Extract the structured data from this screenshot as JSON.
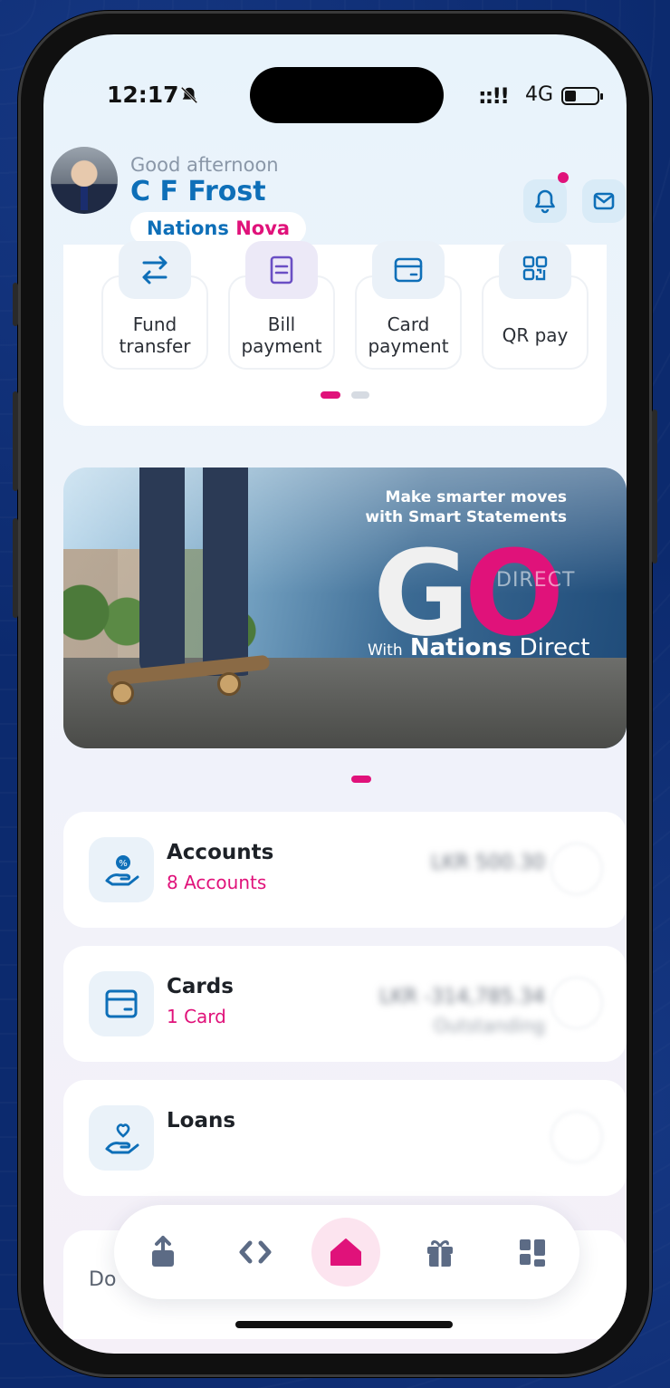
{
  "status_bar": {
    "time": "12:17",
    "network": "4G"
  },
  "header": {
    "greeting": "Good afternoon",
    "user_name": "C F Frost",
    "brand_primary": "Nations",
    "brand_secondary": "Nova"
  },
  "quick_actions": [
    {
      "label_line1": "Fund",
      "label_line2": "transfer",
      "icon": "swap-arrows-icon"
    },
    {
      "label_line1": "Bill",
      "label_line2": "payment",
      "icon": "bill-icon"
    },
    {
      "label_line1": "Card",
      "label_line2": "payment",
      "icon": "card-icon"
    },
    {
      "label_line1": "QR pay",
      "label_line2": "",
      "icon": "qr-code-icon"
    }
  ],
  "banner": {
    "tagline_line1": "Make smarter moves",
    "tagline_line2": "with Smart Statements",
    "go_g": "G",
    "go_o": "O",
    "direct_small": "DIRECT",
    "with": "With",
    "brand_bold": "Nations",
    "brand_rest": " Direct"
  },
  "products": [
    {
      "title": "Accounts",
      "subtitle": "8 Accounts",
      "amount": "LKR 500.30",
      "amount_sub": "",
      "icon": "money-hand-icon"
    },
    {
      "title": "Cards",
      "subtitle": "1 Card",
      "amount": "LKR -314,785.34",
      "amount_sub": "Outstanding",
      "icon": "card-icon"
    },
    {
      "title": "Loans",
      "subtitle": "",
      "amount": "",
      "amount_sub": "",
      "icon": "heart-hand-icon"
    }
  ],
  "partial_section": {
    "text": "Do"
  },
  "bottom_nav": [
    {
      "name": "share",
      "icon": "share-upload-icon"
    },
    {
      "name": "transfer",
      "icon": "code-arrows-icon"
    },
    {
      "name": "home",
      "icon": "home-icon",
      "active": true
    },
    {
      "name": "rewards",
      "icon": "gift-icon"
    },
    {
      "name": "more",
      "icon": "grid-icon"
    }
  ],
  "colors": {
    "primary": "#0e6fb8",
    "accent": "#e0127a",
    "background": "#0c2a6e"
  }
}
